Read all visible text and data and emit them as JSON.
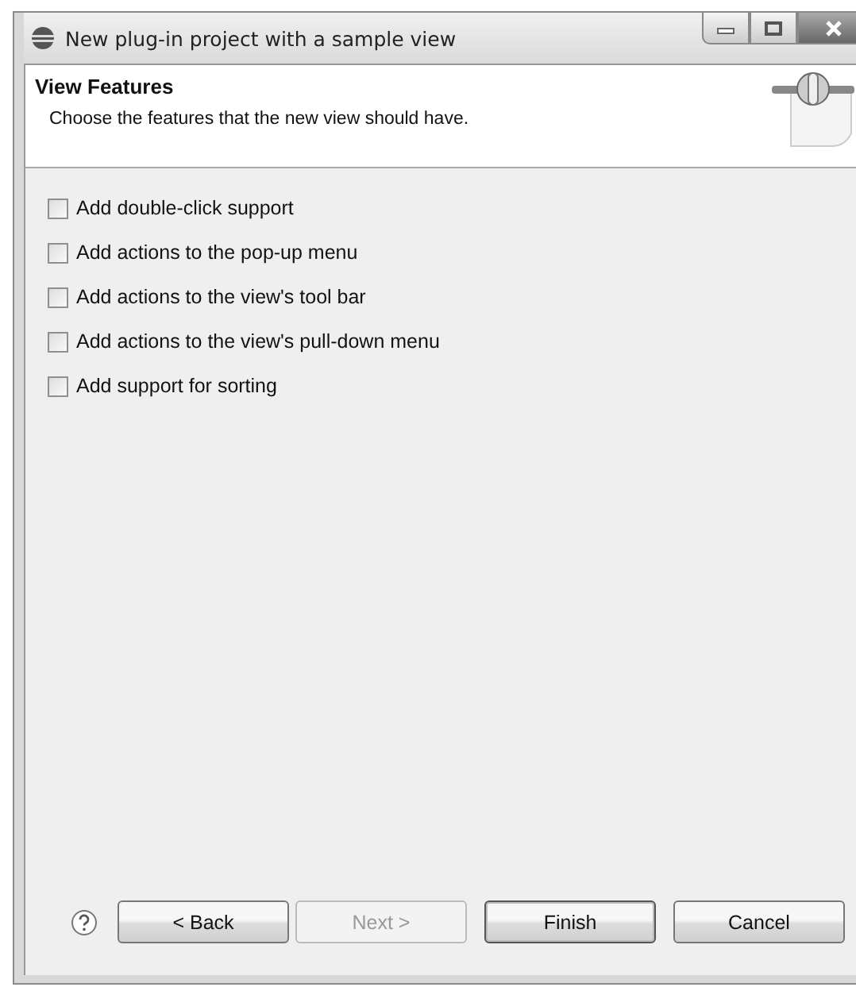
{
  "window": {
    "title": "New plug-in project with a sample view"
  },
  "header": {
    "title": "View Features",
    "description": "Choose the features that the new view should have."
  },
  "options": [
    {
      "label": "Add double-click support",
      "checked": false
    },
    {
      "label": "Add actions to the pop-up menu",
      "checked": false
    },
    {
      "label": "Add actions to the view's tool bar",
      "checked": false
    },
    {
      "label": "Add actions to the view's pull-down menu",
      "checked": false
    },
    {
      "label": "Add support for sorting",
      "checked": false
    }
  ],
  "buttons": [
    {
      "label": "< Back",
      "disabled": false,
      "default": false
    },
    {
      "label": "Next >",
      "disabled": true,
      "default": false
    },
    {
      "label": "Finish",
      "disabled": false,
      "default": true
    },
    {
      "label": "Cancel",
      "disabled": false,
      "default": false
    }
  ]
}
